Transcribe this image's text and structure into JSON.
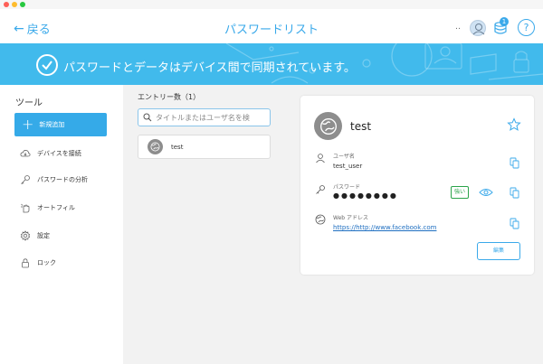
{
  "header": {
    "back_label": "戻る",
    "title": "パスワードリスト",
    "more": "‥",
    "sync_badge": "1",
    "help": "?"
  },
  "banner": {
    "text": "パスワードとデータはデバイス間で同期されています。"
  },
  "sidebar": {
    "heading": "ツール",
    "new_button": "新規追加",
    "items": [
      {
        "label": "デバイスを接続",
        "icon": "cloud-icon"
      },
      {
        "label": "パスワードの分析",
        "icon": "key-icon"
      },
      {
        "label": "オートフィル",
        "icon": "autofill-icon"
      },
      {
        "label": "設定",
        "icon": "gear-icon"
      },
      {
        "label": "ロック",
        "icon": "lock-icon"
      }
    ]
  },
  "list": {
    "count_label": "エントリー数（1）",
    "search_placeholder": "タイトルまたはユーザ名を検",
    "entries": [
      {
        "title": "test"
      }
    ]
  },
  "detail": {
    "title": "test",
    "username_label": "ユーザ名",
    "username": "test_user",
    "password_label": "パスワード",
    "password_masked": "●●●●●●●●",
    "strength": "強い",
    "web_label": "Web アドレス",
    "web_url": "https://http://www.facebook.com",
    "edit_button": "編集"
  },
  "colors": {
    "accent": "#3aa9ea",
    "banner": "#41baec",
    "strong": "#2aa44a"
  }
}
